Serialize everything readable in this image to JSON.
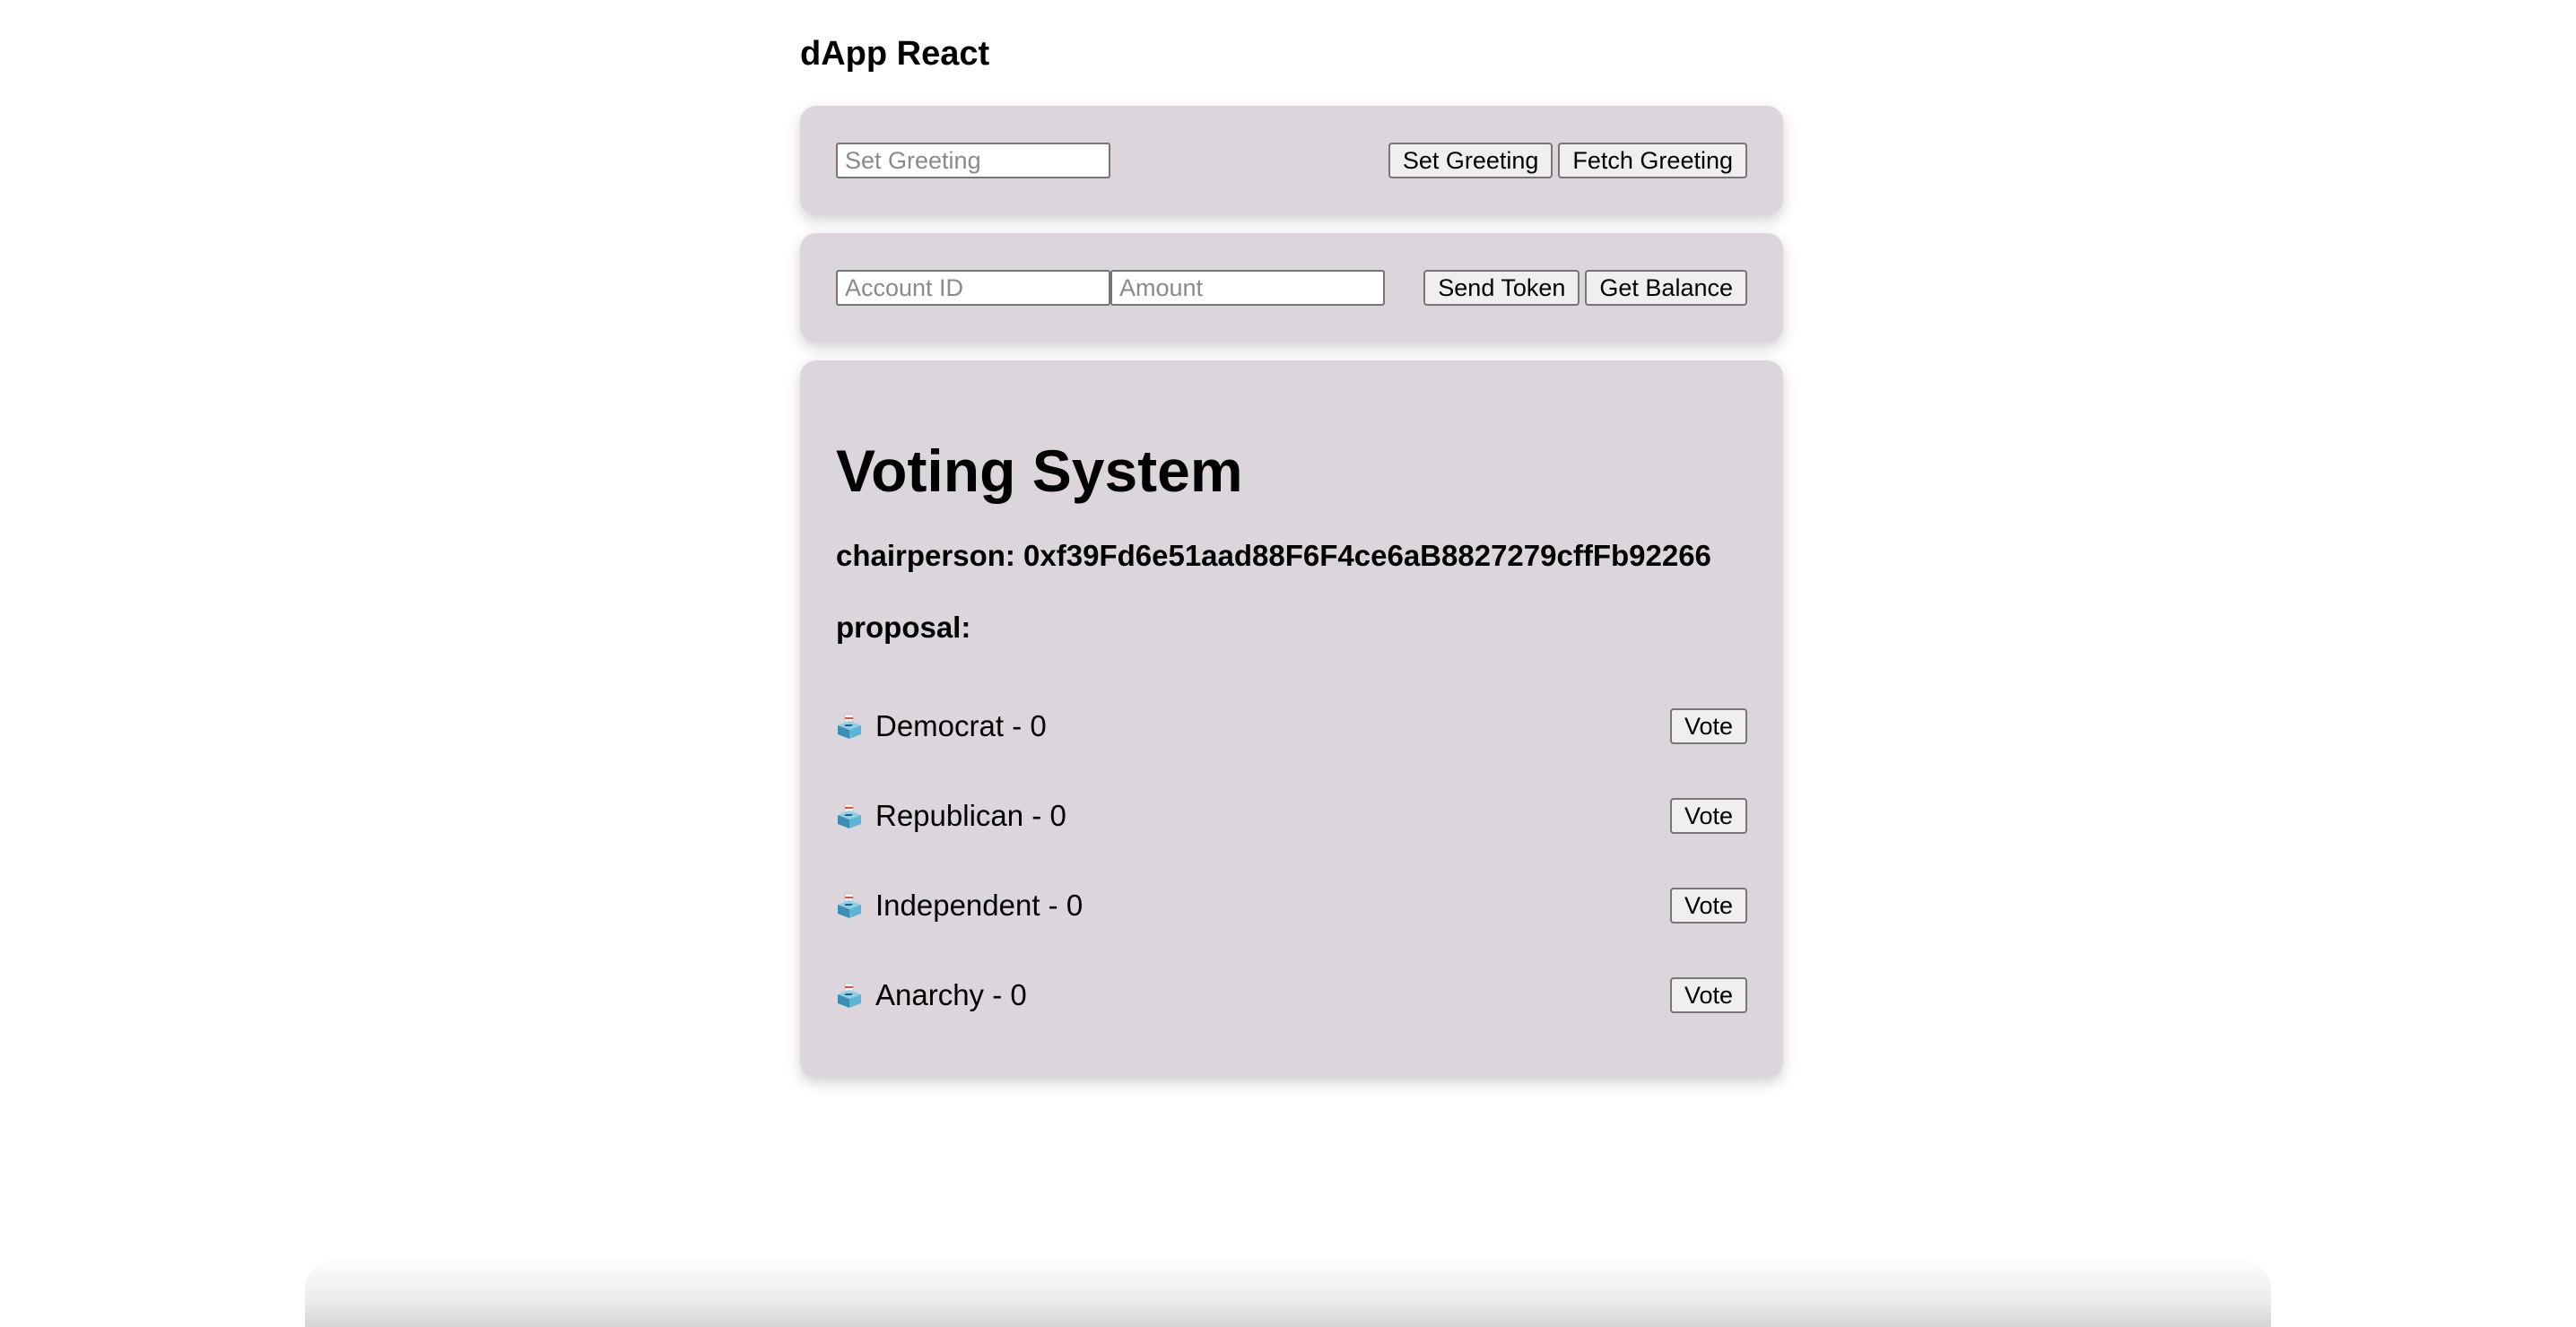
{
  "app": {
    "title": "dApp React"
  },
  "greeting": {
    "input_placeholder": "Set Greeting",
    "input_value": "",
    "set_label": "Set Greeting",
    "fetch_label": "Fetch Greeting"
  },
  "token": {
    "account_placeholder": "Account ID",
    "amount_placeholder": "Amount",
    "send_label": "Send Token",
    "balance_label": "Get Balance"
  },
  "voting": {
    "title": "Voting System",
    "chairperson": "chairperson: 0xf39Fd6e51aad88F6F4ce6aB8827279cffFb92266",
    "proposal_label": "proposal:",
    "vote_label": "Vote",
    "proposals": [
      {
        "icon": "ballot-box-icon",
        "text": "Democrat - 0"
      },
      {
        "icon": "ballot-box-icon",
        "text": "Republican - 0"
      },
      {
        "icon": "ballot-box-icon",
        "text": "Independent - 0"
      },
      {
        "icon": "ballot-box-icon",
        "text": "Anarchy - 0"
      }
    ]
  },
  "colors": {
    "card_background": "#dcd6dc",
    "page_background": "#ffffff",
    "button_background": "#efefef"
  }
}
